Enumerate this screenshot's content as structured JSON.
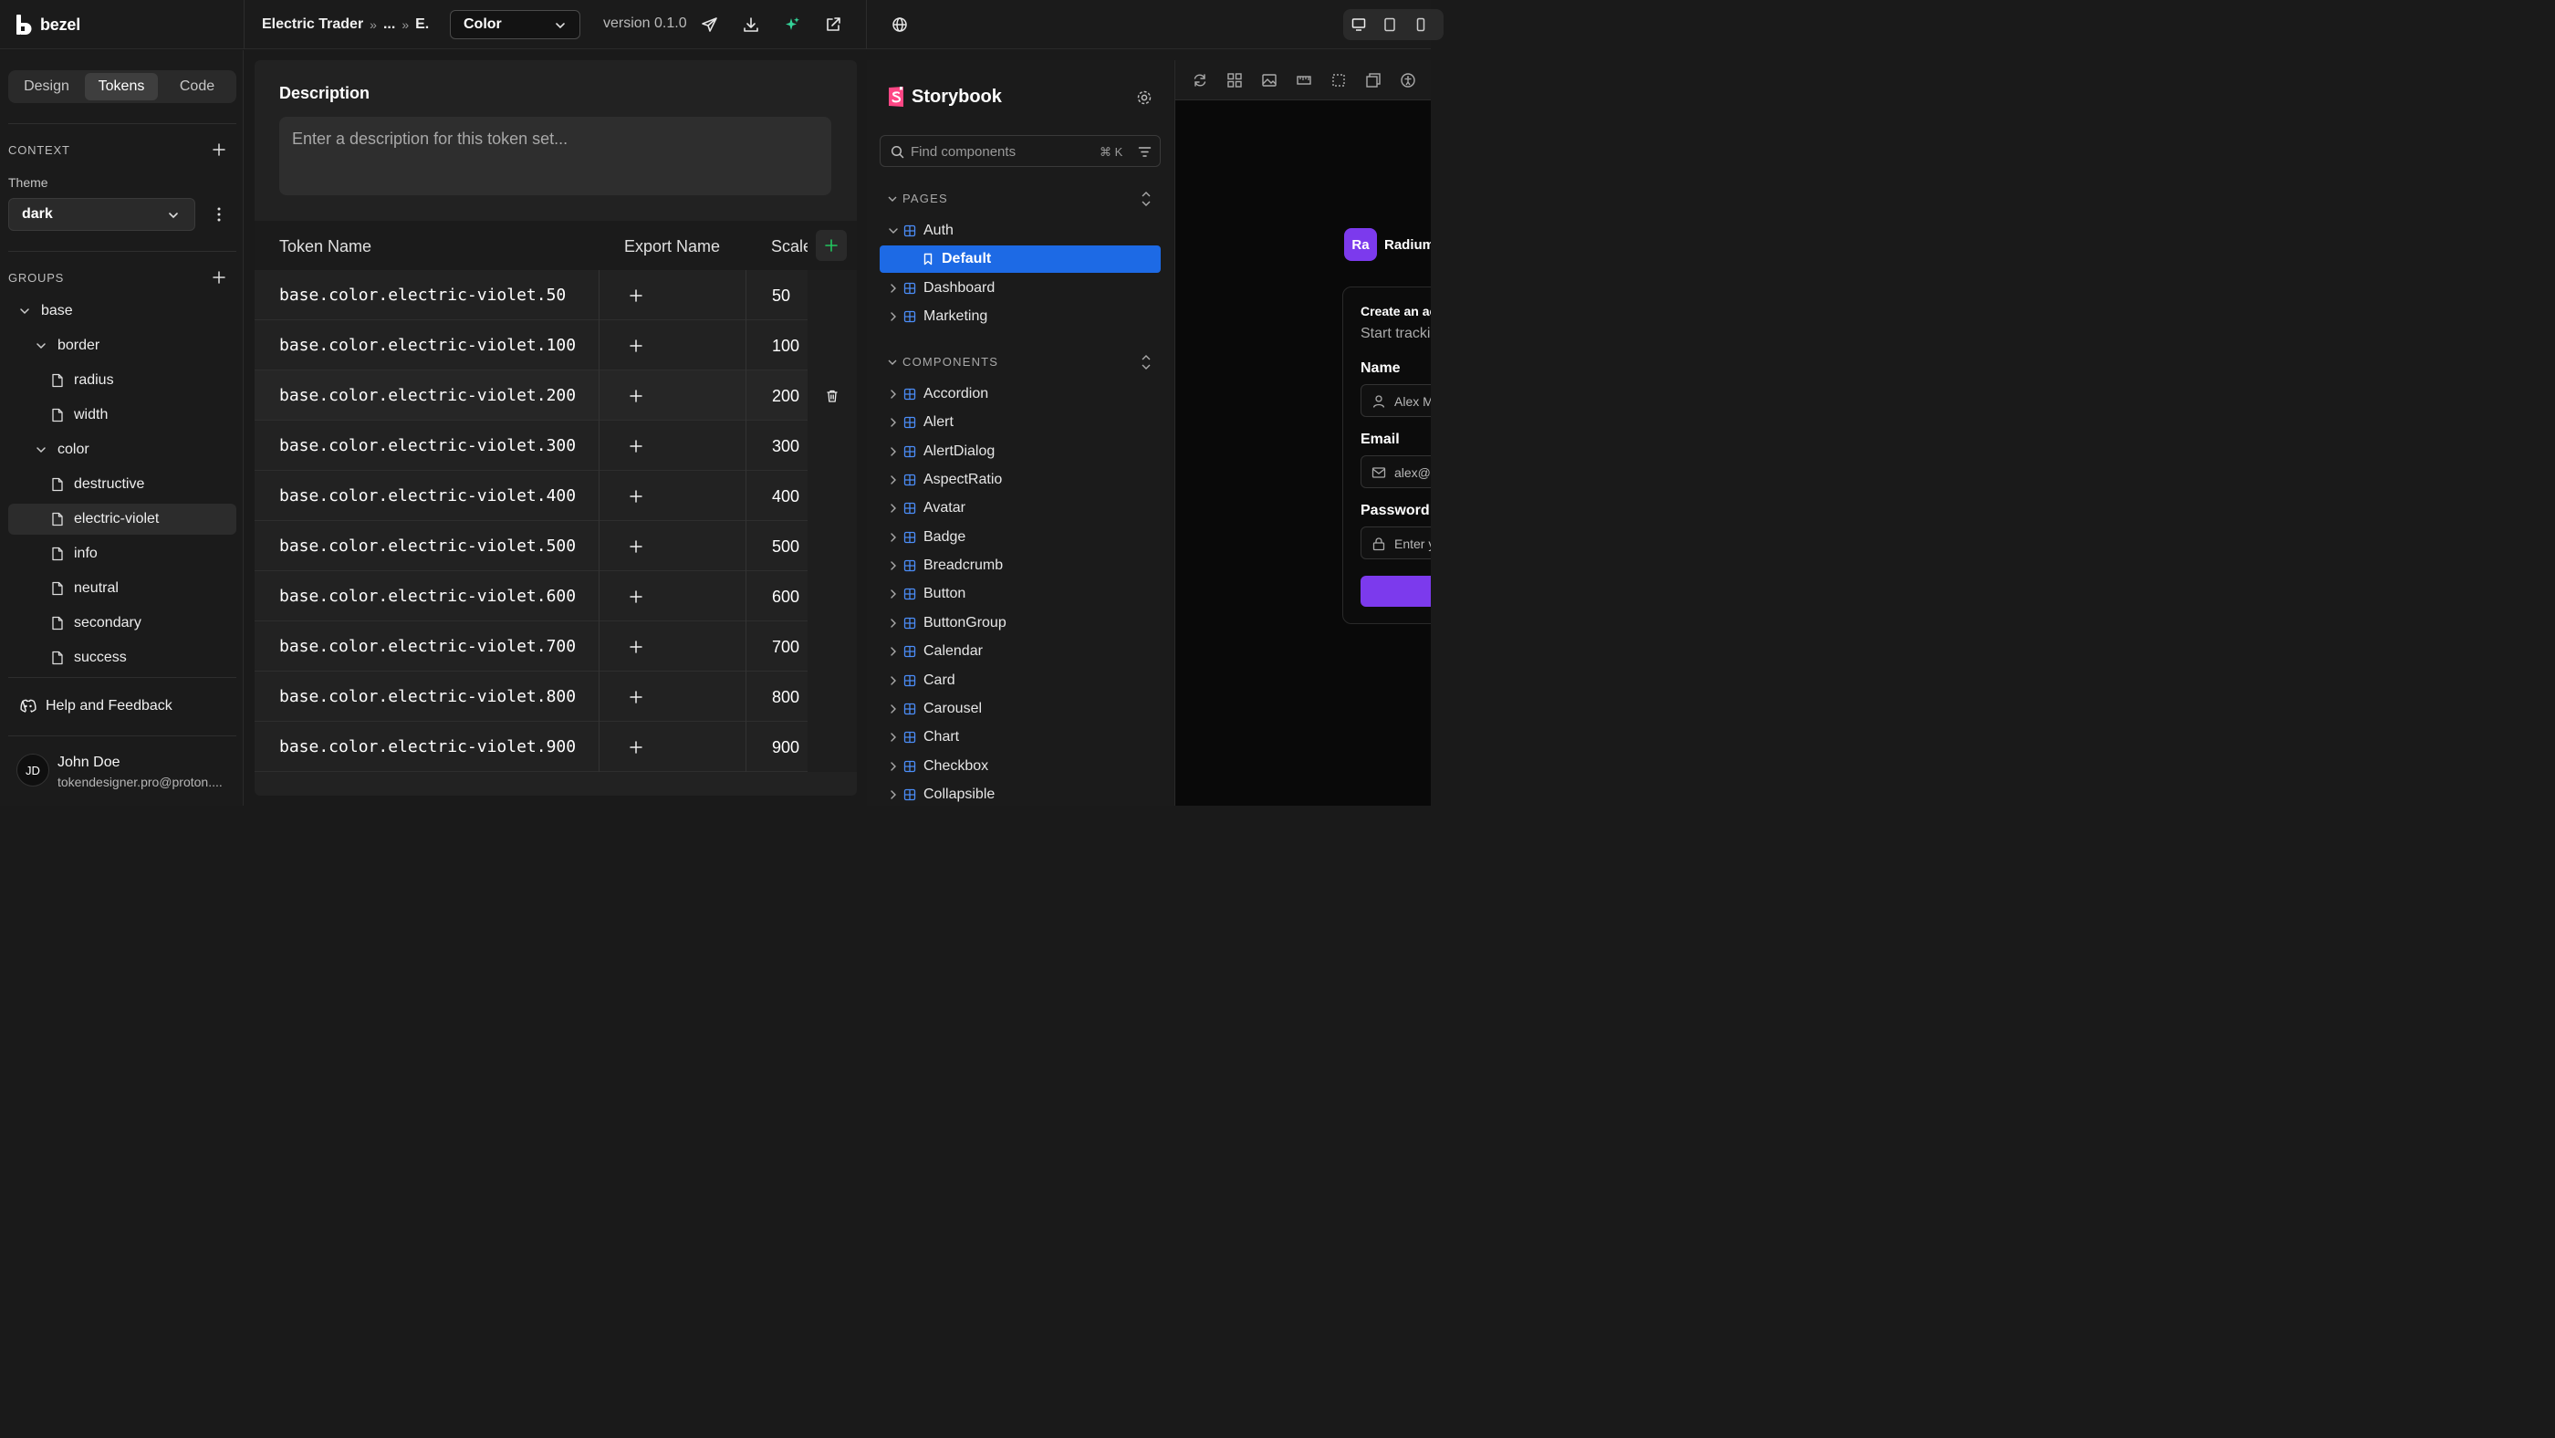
{
  "app": {
    "brand": "bezel",
    "breadcrumb": [
      "Electric Trader",
      "...",
      "E."
    ],
    "breadcrumb_sep": "»",
    "token_set_select": "Color",
    "version": "version 0.1.0"
  },
  "sidebar": {
    "tabs": [
      {
        "label": "Design",
        "active": false
      },
      {
        "label": "Tokens",
        "active": true
      },
      {
        "label": "Code",
        "active": false
      }
    ],
    "context_label": "CONTEXT",
    "theme_label": "Theme",
    "theme_value": "dark",
    "groups_label": "GROUPS",
    "tree": [
      {
        "label": "base",
        "kind": "folder",
        "depth": 0
      },
      {
        "label": "border",
        "kind": "folder",
        "depth": 1
      },
      {
        "label": "radius",
        "kind": "file",
        "depth": 2
      },
      {
        "label": "width",
        "kind": "file",
        "depth": 2
      },
      {
        "label": "color",
        "kind": "folder",
        "depth": 1
      },
      {
        "label": "destructive",
        "kind": "file",
        "depth": 2
      },
      {
        "label": "electric-violet",
        "kind": "file",
        "depth": 2,
        "selected": true
      },
      {
        "label": "info",
        "kind": "file",
        "depth": 2
      },
      {
        "label": "neutral",
        "kind": "file",
        "depth": 2
      },
      {
        "label": "secondary",
        "kind": "file",
        "depth": 2
      },
      {
        "label": "success",
        "kind": "file",
        "depth": 2
      }
    ],
    "help_label": "Help and Feedback",
    "user": {
      "initials": "JD",
      "name": "John Doe",
      "email": "tokendesigner.pro@proton...."
    }
  },
  "editor": {
    "description_title": "Description",
    "description_placeholder": "Enter a description for this token set...",
    "columns": [
      "Token Name",
      "Export Name",
      "Scale"
    ],
    "rows": [
      {
        "name": "base.color.electric-violet.50",
        "scale": "50"
      },
      {
        "name": "base.color.electric-violet.100",
        "scale": "100"
      },
      {
        "name": "base.color.electric-violet.200",
        "scale": "200",
        "hovered": true
      },
      {
        "name": "base.color.electric-violet.300",
        "scale": "300"
      },
      {
        "name": "base.color.electric-violet.400",
        "scale": "400"
      },
      {
        "name": "base.color.electric-violet.500",
        "scale": "500"
      },
      {
        "name": "base.color.electric-violet.600",
        "scale": "600"
      },
      {
        "name": "base.color.electric-violet.700",
        "scale": "700"
      },
      {
        "name": "base.color.electric-violet.800",
        "scale": "800"
      },
      {
        "name": "base.color.electric-violet.900",
        "scale": "900"
      }
    ]
  },
  "storybook": {
    "title": "Storybook",
    "search_placeholder": "Find components",
    "search_shortcut": "⌘ K",
    "pages_label": "PAGES",
    "pages": [
      {
        "label": "Auth",
        "expanded": true
      },
      {
        "label": "Default",
        "story": true,
        "active": true
      },
      {
        "label": "Dashboard"
      },
      {
        "label": "Marketing"
      }
    ],
    "components_label": "COMPONENTS",
    "components": [
      "Accordion",
      "Alert",
      "AlertDialog",
      "AspectRatio",
      "Avatar",
      "Badge",
      "Breadcrumb",
      "Button",
      "ButtonGroup",
      "Calendar",
      "Card",
      "Carousel",
      "Chart",
      "Checkbox",
      "Collapsible"
    ]
  },
  "preview": {
    "avatar": "Ra",
    "brand": "Radium",
    "card_title": "Create an ac",
    "card_subtitle": "Start tracki",
    "name_label": "Name",
    "name_value": "Alex M",
    "email_label": "Email",
    "email_value": "alex@c",
    "password_label": "Password",
    "password_value": "Enter y"
  },
  "colors": {
    "accent_blue": "#1d6ae5",
    "violet": "#7c3aed",
    "storybook_pink": "#ff4785",
    "ai_green": "#34d399"
  }
}
